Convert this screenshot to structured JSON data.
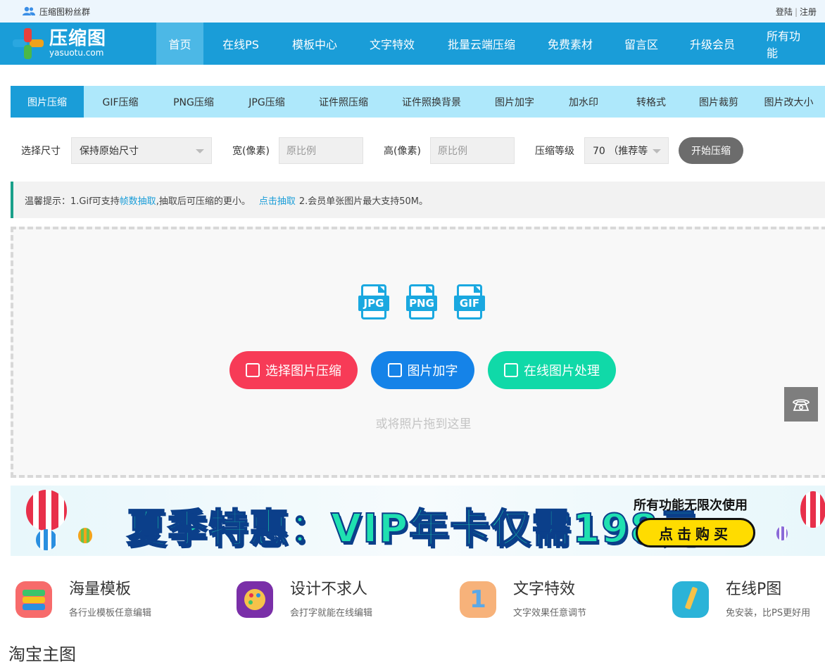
{
  "topbar": {
    "group_label": "压缩图粉丝群",
    "login": "登陆",
    "sep": "|",
    "register": "注册"
  },
  "logo": {
    "name": "压缩图",
    "domain": "yasuotu.com"
  },
  "nav": [
    {
      "label": "首页",
      "active": true
    },
    {
      "label": "在线PS"
    },
    {
      "label": "模板中心"
    },
    {
      "label": "文字特效"
    },
    {
      "label": "批量云端压缩"
    },
    {
      "label": "免费素材"
    },
    {
      "label": "留言区"
    },
    {
      "label": "升级会员"
    },
    {
      "label": "所有功能"
    }
  ],
  "tabs": [
    {
      "label": "图片压缩",
      "active": true
    },
    {
      "label": "GIF压缩"
    },
    {
      "label": "PNG压缩"
    },
    {
      "label": "JPG压缩"
    },
    {
      "label": "证件照压缩"
    },
    {
      "label": "证件照换背景"
    },
    {
      "label": "图片加字"
    },
    {
      "label": "加水印"
    },
    {
      "label": "转格式"
    },
    {
      "label": "图片裁剪"
    },
    {
      "label": "图片改大小"
    }
  ],
  "form": {
    "size_label": "选择尺寸",
    "size_value": "保持原始尺寸",
    "width_label": "宽(像素)",
    "width_placeholder": "原比例",
    "height_label": "高(像素)",
    "height_placeholder": "原比例",
    "level_label": "压缩等级",
    "level_value": "70 （推荐等",
    "start_button": "开始压缩"
  },
  "tip": {
    "prefix": "温馨提示：1.Gif可支持",
    "link1": "帧数抽取",
    "middle": ",抽取后可压缩的更小。",
    "link2": "点击抽取",
    "suffix": "2.会员单张图片最大支持50M。"
  },
  "upload": {
    "file_types": [
      "JPG",
      "PNG",
      "GIF"
    ],
    "select_button": "选择图片压缩",
    "text_button": "图片加字",
    "online_button": "在线图片处理",
    "drag_hint": "或将照片拖到这里"
  },
  "banner": {
    "headline": "夏季特惠：VIP年卡仅需198元",
    "subtitle": "所有功能无限次使用",
    "buy": "点击购买"
  },
  "features": [
    {
      "title": "海量模板",
      "desc": "各行业模板任意编辑"
    },
    {
      "title": "设计不求人",
      "desc": "会打字就能在线编辑"
    },
    {
      "title": "文字特效",
      "desc": "文字效果任意调节"
    },
    {
      "title": "在线P图",
      "desc": "免安装，比PS更好用"
    }
  ],
  "section_title": "淘宝主图",
  "colors": {
    "primary": "#1a9dd8",
    "tab_bg": "#aee8fb",
    "red": "#f73b57",
    "blue": "#1583e8",
    "green": "#10d9a8"
  }
}
